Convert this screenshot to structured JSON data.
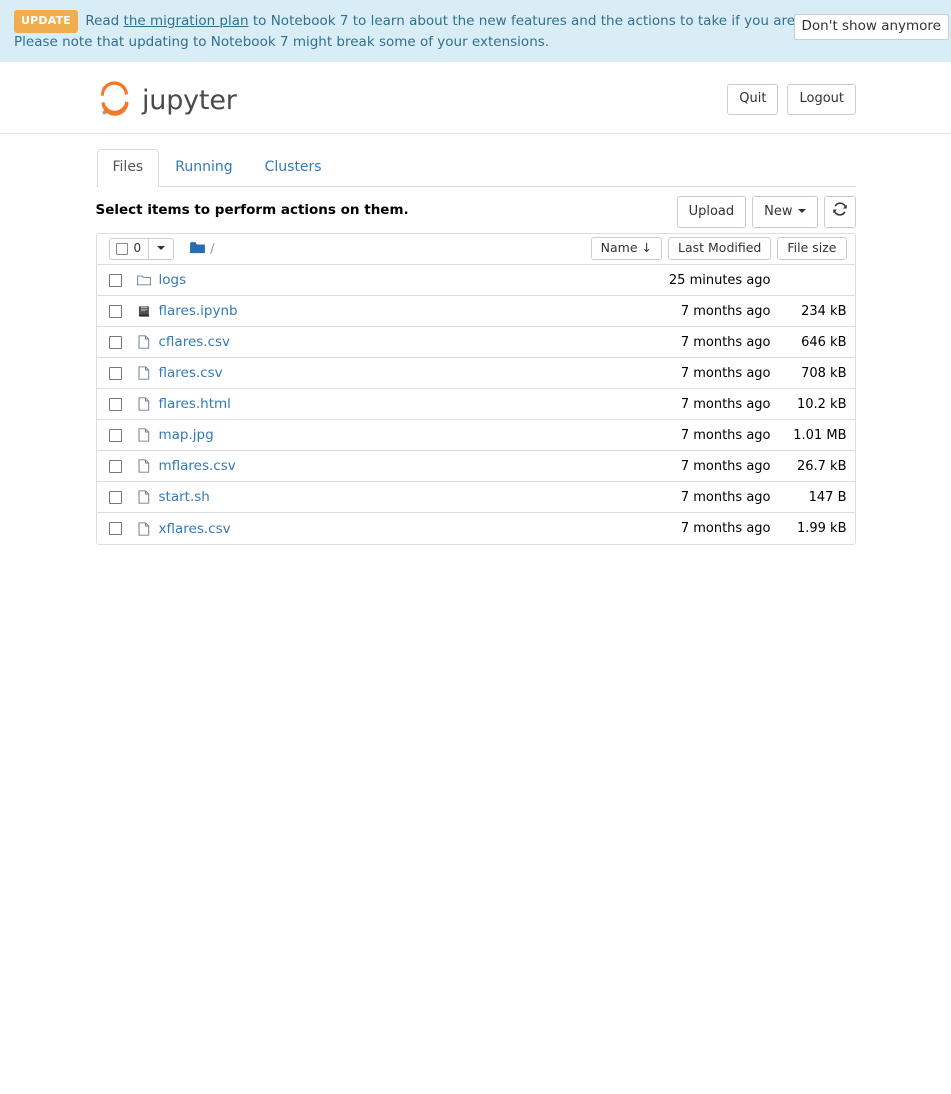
{
  "notification": {
    "badge": "UPDATE",
    "text_before_link": "Read ",
    "link_text": "the migration plan",
    "text_after_link": " to Notebook 7 to learn about the new features and the actions to take if you are using extensions - Please note that updating to Notebook 7 might break some of your extensions.",
    "dismiss_label": "Don't show anymore",
    "bg_color": "#d9edf7",
    "text_color": "#31708f",
    "badge_color": "#f0ad4e"
  },
  "header": {
    "brand": "jupyter",
    "logo_icon": "jupyter-logo-icon",
    "quit_label": "Quit",
    "logout_label": "Logout"
  },
  "tabs": [
    {
      "label": "Files",
      "active": true
    },
    {
      "label": "Running",
      "active": false
    },
    {
      "label": "Clusters",
      "active": false
    }
  ],
  "toolbar": {
    "hint": "Select items to perform actions on them.",
    "upload_label": "Upload",
    "new_label": "New",
    "refresh_icon": "refresh-icon"
  },
  "list_header": {
    "selected_count": "0",
    "dropdown_icon": "chevron-down-icon",
    "folder_icon": "folder-icon",
    "breadcrumb_path": "/",
    "sorters": [
      {
        "label": "Name",
        "arrow": "↓",
        "name": "sort-name"
      },
      {
        "label": "Last Modified",
        "arrow": "",
        "name": "sort-last-modified"
      },
      {
        "label": "File size",
        "arrow": "",
        "name": "sort-file-size"
      }
    ]
  },
  "files": [
    {
      "name": "logs",
      "icon": "folder-outline-icon",
      "modified": "25 minutes ago",
      "size": ""
    },
    {
      "name": "flares.ipynb",
      "icon": "notebook-icon",
      "modified": "7 months ago",
      "size": "234 kB"
    },
    {
      "name": "cflares.csv",
      "icon": "file-icon",
      "modified": "7 months ago",
      "size": "646 kB"
    },
    {
      "name": "flares.csv",
      "icon": "file-icon",
      "modified": "7 months ago",
      "size": "708 kB"
    },
    {
      "name": "flares.html",
      "icon": "file-icon",
      "modified": "7 months ago",
      "size": "10.2 kB"
    },
    {
      "name": "map.jpg",
      "icon": "file-icon",
      "modified": "7 months ago",
      "size": "1.01 MB"
    },
    {
      "name": "mflares.csv",
      "icon": "file-icon",
      "modified": "7 months ago",
      "size": "26.7 kB"
    },
    {
      "name": "start.sh",
      "icon": "file-icon",
      "modified": "7 months ago",
      "size": "147 B"
    },
    {
      "name": "xflares.csv",
      "icon": "file-icon",
      "modified": "7 months ago",
      "size": "1.99 kB"
    }
  ]
}
